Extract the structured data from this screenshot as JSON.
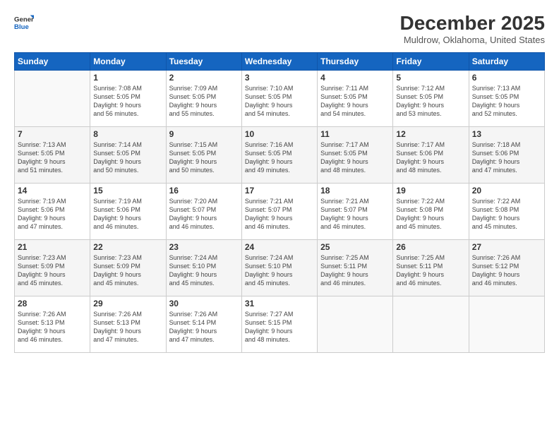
{
  "header": {
    "logo_general": "General",
    "logo_blue": "Blue",
    "month_title": "December 2025",
    "location": "Muldrow, Oklahoma, United States"
  },
  "calendar": {
    "days_of_week": [
      "Sunday",
      "Monday",
      "Tuesday",
      "Wednesday",
      "Thursday",
      "Friday",
      "Saturday"
    ],
    "weeks": [
      [
        {
          "day": "",
          "info": ""
        },
        {
          "day": "1",
          "info": "Sunrise: 7:08 AM\nSunset: 5:05 PM\nDaylight: 9 hours\nand 56 minutes."
        },
        {
          "day": "2",
          "info": "Sunrise: 7:09 AM\nSunset: 5:05 PM\nDaylight: 9 hours\nand 55 minutes."
        },
        {
          "day": "3",
          "info": "Sunrise: 7:10 AM\nSunset: 5:05 PM\nDaylight: 9 hours\nand 54 minutes."
        },
        {
          "day": "4",
          "info": "Sunrise: 7:11 AM\nSunset: 5:05 PM\nDaylight: 9 hours\nand 54 minutes."
        },
        {
          "day": "5",
          "info": "Sunrise: 7:12 AM\nSunset: 5:05 PM\nDaylight: 9 hours\nand 53 minutes."
        },
        {
          "day": "6",
          "info": "Sunrise: 7:13 AM\nSunset: 5:05 PM\nDaylight: 9 hours\nand 52 minutes."
        }
      ],
      [
        {
          "day": "7",
          "info": "Sunrise: 7:13 AM\nSunset: 5:05 PM\nDaylight: 9 hours\nand 51 minutes."
        },
        {
          "day": "8",
          "info": "Sunrise: 7:14 AM\nSunset: 5:05 PM\nDaylight: 9 hours\nand 50 minutes."
        },
        {
          "day": "9",
          "info": "Sunrise: 7:15 AM\nSunset: 5:05 PM\nDaylight: 9 hours\nand 50 minutes."
        },
        {
          "day": "10",
          "info": "Sunrise: 7:16 AM\nSunset: 5:05 PM\nDaylight: 9 hours\nand 49 minutes."
        },
        {
          "day": "11",
          "info": "Sunrise: 7:17 AM\nSunset: 5:05 PM\nDaylight: 9 hours\nand 48 minutes."
        },
        {
          "day": "12",
          "info": "Sunrise: 7:17 AM\nSunset: 5:06 PM\nDaylight: 9 hours\nand 48 minutes."
        },
        {
          "day": "13",
          "info": "Sunrise: 7:18 AM\nSunset: 5:06 PM\nDaylight: 9 hours\nand 47 minutes."
        }
      ],
      [
        {
          "day": "14",
          "info": "Sunrise: 7:19 AM\nSunset: 5:06 PM\nDaylight: 9 hours\nand 47 minutes."
        },
        {
          "day": "15",
          "info": "Sunrise: 7:19 AM\nSunset: 5:06 PM\nDaylight: 9 hours\nand 46 minutes."
        },
        {
          "day": "16",
          "info": "Sunrise: 7:20 AM\nSunset: 5:07 PM\nDaylight: 9 hours\nand 46 minutes."
        },
        {
          "day": "17",
          "info": "Sunrise: 7:21 AM\nSunset: 5:07 PM\nDaylight: 9 hours\nand 46 minutes."
        },
        {
          "day": "18",
          "info": "Sunrise: 7:21 AM\nSunset: 5:07 PM\nDaylight: 9 hours\nand 46 minutes."
        },
        {
          "day": "19",
          "info": "Sunrise: 7:22 AM\nSunset: 5:08 PM\nDaylight: 9 hours\nand 45 minutes."
        },
        {
          "day": "20",
          "info": "Sunrise: 7:22 AM\nSunset: 5:08 PM\nDaylight: 9 hours\nand 45 minutes."
        }
      ],
      [
        {
          "day": "21",
          "info": "Sunrise: 7:23 AM\nSunset: 5:09 PM\nDaylight: 9 hours\nand 45 minutes."
        },
        {
          "day": "22",
          "info": "Sunrise: 7:23 AM\nSunset: 5:09 PM\nDaylight: 9 hours\nand 45 minutes."
        },
        {
          "day": "23",
          "info": "Sunrise: 7:24 AM\nSunset: 5:10 PM\nDaylight: 9 hours\nand 45 minutes."
        },
        {
          "day": "24",
          "info": "Sunrise: 7:24 AM\nSunset: 5:10 PM\nDaylight: 9 hours\nand 45 minutes."
        },
        {
          "day": "25",
          "info": "Sunrise: 7:25 AM\nSunset: 5:11 PM\nDaylight: 9 hours\nand 46 minutes."
        },
        {
          "day": "26",
          "info": "Sunrise: 7:25 AM\nSunset: 5:11 PM\nDaylight: 9 hours\nand 46 minutes."
        },
        {
          "day": "27",
          "info": "Sunrise: 7:26 AM\nSunset: 5:12 PM\nDaylight: 9 hours\nand 46 minutes."
        }
      ],
      [
        {
          "day": "28",
          "info": "Sunrise: 7:26 AM\nSunset: 5:13 PM\nDaylight: 9 hours\nand 46 minutes."
        },
        {
          "day": "29",
          "info": "Sunrise: 7:26 AM\nSunset: 5:13 PM\nDaylight: 9 hours\nand 47 minutes."
        },
        {
          "day": "30",
          "info": "Sunrise: 7:26 AM\nSunset: 5:14 PM\nDaylight: 9 hours\nand 47 minutes."
        },
        {
          "day": "31",
          "info": "Sunrise: 7:27 AM\nSunset: 5:15 PM\nDaylight: 9 hours\nand 48 minutes."
        },
        {
          "day": "",
          "info": ""
        },
        {
          "day": "",
          "info": ""
        },
        {
          "day": "",
          "info": ""
        }
      ]
    ]
  }
}
